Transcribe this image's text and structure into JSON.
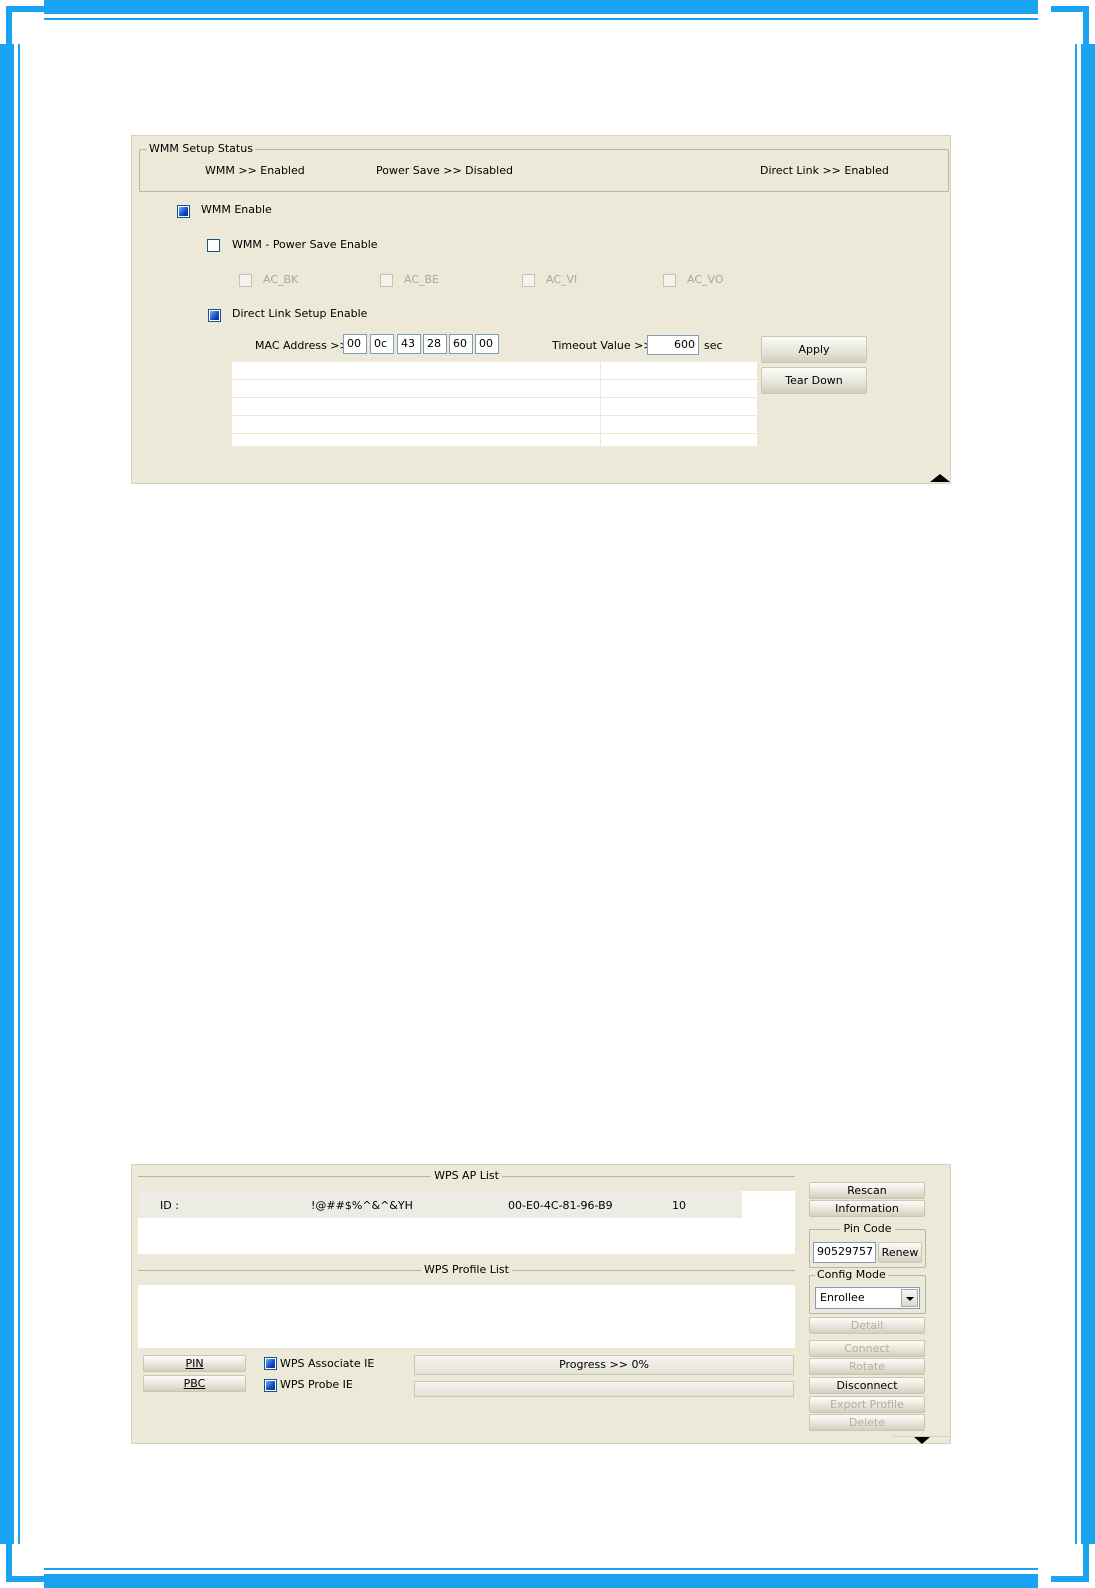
{
  "wmm_panel": {
    "status_group_title": "WMM Setup Status",
    "status_wmm": "WMM >> Enabled",
    "status_power_save": "Power Save >> Disabled",
    "status_direct_link": "Direct Link >> Enabled",
    "wmm_enable": {
      "label": "WMM Enable",
      "checked": true
    },
    "power_save_enable": {
      "label": "WMM - Power Save Enable",
      "checked": false
    },
    "ac_options": [
      {
        "label": "AC_BK"
      },
      {
        "label": "AC_BE"
      },
      {
        "label": "AC_VI"
      },
      {
        "label": "AC_VO"
      }
    ],
    "direct_link_enable": {
      "label": "Direct Link Setup Enable",
      "checked": true
    },
    "mac_label": "MAC Address >>",
    "mac_octets": [
      "00",
      "0c",
      "43",
      "28",
      "60",
      "00"
    ],
    "timeout_label": "Timeout Value >>",
    "timeout_value": "600",
    "timeout_unit": "sec",
    "apply_label": "Apply",
    "tear_down_label": "Tear Down"
  },
  "wps_panel": {
    "ap_list_title": "WPS AP List",
    "ap_row": {
      "id_label": "ID :",
      "ssid": "!@##$%^&^&YH",
      "bssid": "00-E0-4C-81-96-B9",
      "channel": "10"
    },
    "profile_list_title": "WPS Profile List",
    "pin_button": "PIN",
    "pbc_button": "PBC",
    "associate_ie": {
      "label": "WPS Associate IE",
      "checked": true
    },
    "probe_ie": {
      "label": "WPS Probe IE",
      "checked": true
    },
    "progress_text": "Progress >> 0%",
    "progress_value": 0,
    "rescan_label": "Rescan",
    "information_label": "Information",
    "pin_code_title": "Pin Code",
    "pin_code_value": "90529757",
    "renew_label": "Renew",
    "config_mode_title": "Config Mode",
    "config_mode_value": "Enrollee",
    "detail_label": "Detail",
    "connect_label": "Connect",
    "rotate_label": "Rotate",
    "disconnect_label": "Disconnect",
    "export_profile_label": "Export Profile",
    "delete_label": "Delete"
  },
  "colors": {
    "frame": "#1aa3f0",
    "panel_bg": "#ece9d8"
  }
}
